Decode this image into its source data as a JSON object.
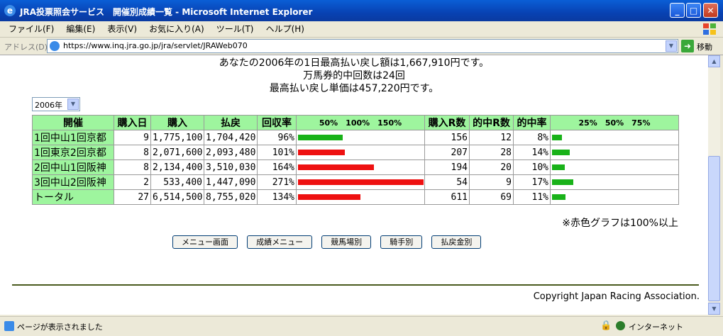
{
  "window": {
    "title": "JRA投票照会サービス　開催別成績一覧 - Microsoft Internet Explorer",
    "min": "_",
    "max": "□",
    "close": "✕"
  },
  "menu": [
    "ファイル(F)",
    "編集(E)",
    "表示(V)",
    "お気に入り(A)",
    "ツール(T)",
    "ヘルプ(H)"
  ],
  "address": {
    "label": "アドレス(D)",
    "url": "https://www.inq.jra.go.jp/jra/servlet/JRAWeb070",
    "go": "移動"
  },
  "summary": {
    "line1": "あなたの2006年の1日最高払い戻し額は1,667,910円です。",
    "line2": "万馬券的中回数は24回",
    "line3": "最高払い戻し単価は457,220円です。"
  },
  "year_select": {
    "value": "2006年"
  },
  "table": {
    "headers": {
      "kaisai": "開催",
      "kounyuubi": "購入日",
      "kounyuu": "購入",
      "haraimodoshi": "払戻",
      "kaishuuritsu": "回収率",
      "scale1": "50%　100%　150%",
      "kounyuuR": "購入R数",
      "tekichuuR": "的中R数",
      "tekichuuritsu": "的中率",
      "scale2": "25%　50%　75%"
    },
    "rows": [
      {
        "name": "1回中山1回京都",
        "days": "9",
        "buy": "1,775,100",
        "ret": "1,704,420",
        "rate": "96%",
        "rate_value": 96,
        "races": "156",
        "hits": "12",
        "hitrate": "8%",
        "hitrate_value": 8
      },
      {
        "name": "1回東京2回京都",
        "days": "8",
        "buy": "2,071,600",
        "ret": "2,093,480",
        "rate": "101%",
        "rate_value": 101,
        "races": "207",
        "hits": "28",
        "hitrate": "14%",
        "hitrate_value": 14
      },
      {
        "name": "2回中山1回阪神",
        "days": "8",
        "buy": "2,134,400",
        "ret": "3,510,030",
        "rate": "164%",
        "rate_value": 164,
        "races": "194",
        "hits": "20",
        "hitrate": "10%",
        "hitrate_value": 10
      },
      {
        "name": "3回中山2回阪神",
        "days": "2",
        "buy": "533,400",
        "ret": "1,447,090",
        "rate": "271%",
        "rate_value": 271,
        "races": "54",
        "hits": "9",
        "hitrate": "17%",
        "hitrate_value": 17
      },
      {
        "name": "トータル",
        "days": "27",
        "buy": "6,514,500",
        "ret": "8,755,020",
        "rate": "134%",
        "rate_value": 134,
        "races": "611",
        "hits": "69",
        "hitrate": "11%",
        "hitrate_value": 11
      }
    ]
  },
  "note": "※赤色グラフは100%以上",
  "nav_buttons": [
    "メニュー画面",
    "成績メニュー",
    "競馬場別",
    "騎手別",
    "払戻金別"
  ],
  "copyright": "Copyright Japan Racing Association.",
  "status": {
    "text": "ページが表示されました",
    "zone": "インターネット"
  },
  "colors": {
    "header_bg": "#9ef59e",
    "bar_red": "#ee1111",
    "bar_green": "#19b219"
  }
}
